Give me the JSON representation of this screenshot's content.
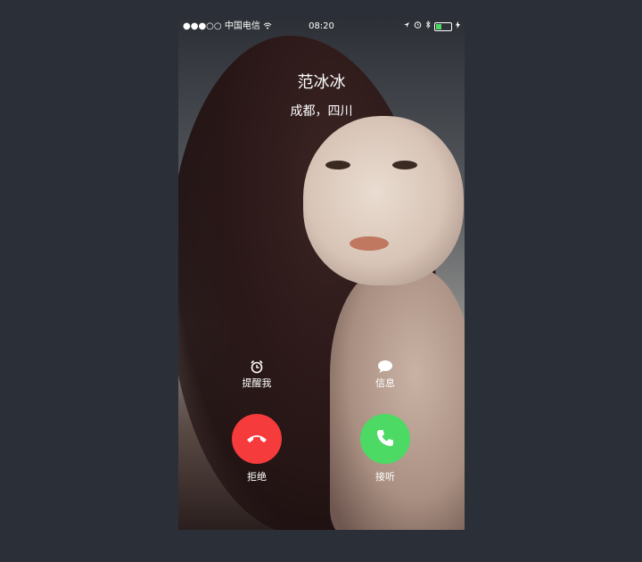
{
  "status_bar": {
    "signal": "●●●○○",
    "carrier": "中国电信",
    "time": "08:20"
  },
  "caller": {
    "name": "范冰冰",
    "location": "成都，四川"
  },
  "actions": {
    "remind_label": "提醒我",
    "message_label": "信息"
  },
  "buttons": {
    "decline_label": "拒绝",
    "accept_label": "接听"
  },
  "colors": {
    "decline": "#f53b3b",
    "accept": "#4cd964",
    "page_bg": "#2a2f38"
  }
}
